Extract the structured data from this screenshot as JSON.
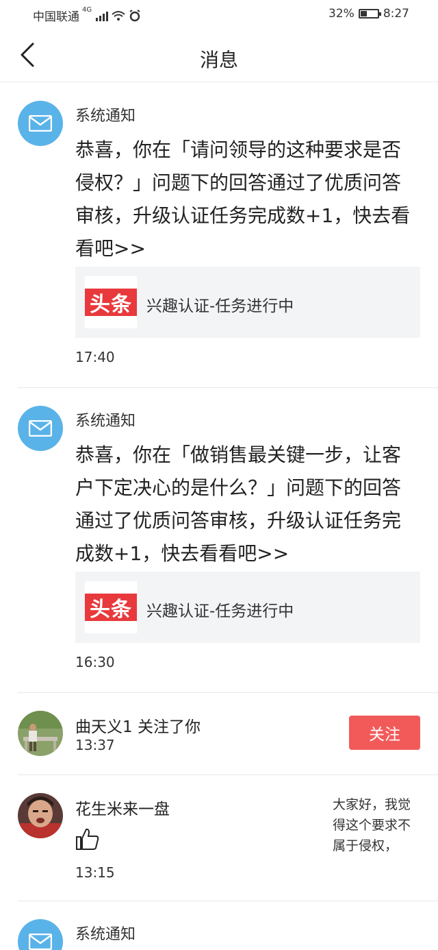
{
  "status_bar": {
    "carrier": "中国联通",
    "network": "4G",
    "battery": "32%",
    "time": "8:27"
  },
  "nav": {
    "title": "消息"
  },
  "messages": [
    {
      "sender": "系统通知",
      "body": "恭喜，你在「请问领导的这种要求是否侵权？」问题下的回答通过了优质问答审核，升级认证任务完成数+1，快去看看吧>>",
      "card_logo": "头条",
      "card_text": "兴趣认证-任务进行中",
      "time": "17:40"
    },
    {
      "sender": "系统通知",
      "body": "恭喜，你在「做销售最关键一步，让客户下定决心的是什么？」问题下的回答通过了优质问答审核，升级认证任务完成数+1，快去看看吧>>",
      "card_logo": "头条",
      "card_text": "兴趣认证-任务进行中",
      "time": "16:30"
    },
    {
      "text": "曲天义1 关注了你",
      "time": "13:37",
      "button": "关注"
    },
    {
      "name": "花生米来一盘",
      "time": "13:15",
      "quote": "大家好，我觉得这个要求不属于侵权，"
    },
    {
      "sender": "系统通知"
    }
  ],
  "colors": {
    "mail_avatar": "#5ab3e8",
    "follow_button": "#f25a5a",
    "logo_red": "#e8393c",
    "card_bg": "#f3f4f6"
  }
}
